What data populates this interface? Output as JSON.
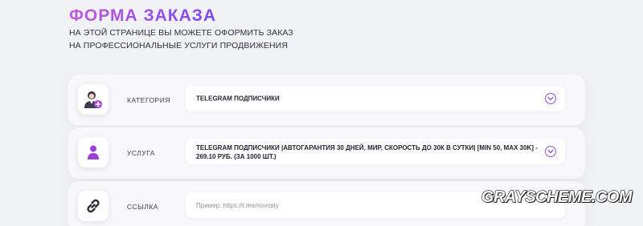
{
  "header": {
    "title": "ФОРМА ЗАКАЗА",
    "subtitle_line1": "НА ЭТОЙ СТРАНИЦЕ ВЫ МОЖЕТЕ ОФОРМИТЬ ЗАКАЗ",
    "subtitle_line2": "НА ПРОФЕССИОНАЛЬНЫЕ УСЛУГИ ПРОДВИЖЕНИЯ"
  },
  "form": {
    "category": {
      "icon": "user-add-icon",
      "label": "КАТЕГОРИЯ",
      "value": "TELEGRAM ПОДПИСЧИКИ"
    },
    "service": {
      "icon": "user-icon",
      "label": "УСЛУГА",
      "value": "TELEGRAM ПОДПИСЧИКИ |АВТОГАРАНТИЯ 30 ДНЕЙ, МИР, СКОРОСТЬ ДО 30К В СУТКИ| [MIN 50, MAX 30K] - 269.10 РУБ. (ЗА 1000 ШТ.)"
    },
    "link": {
      "icon": "link-icon",
      "label": "ССЫЛКА",
      "value": "",
      "placeholder": "Пример: https://t.me/novosty"
    }
  },
  "watermark": "GRAYSCHEME.COM",
  "colors": {
    "accent": "#9a4ee6",
    "background": "#f1f2f5",
    "card": "#f8f8fb"
  }
}
